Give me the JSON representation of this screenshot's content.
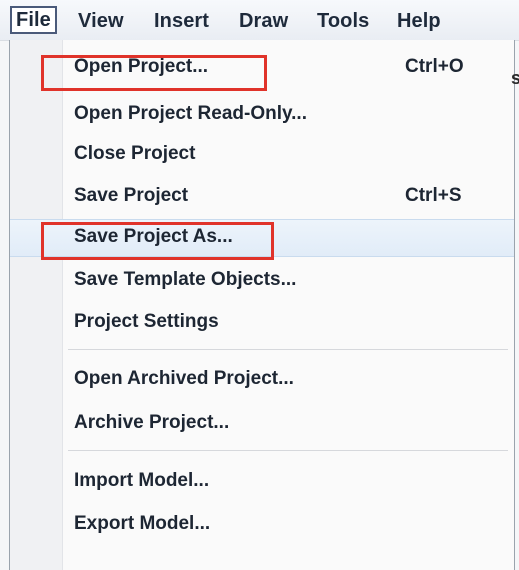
{
  "menubar": {
    "items": [
      {
        "label": "File"
      },
      {
        "label": "View"
      },
      {
        "label": "Insert"
      },
      {
        "label": "Draw"
      },
      {
        "label": "Tools"
      },
      {
        "label": "Help"
      }
    ]
  },
  "file_menu": {
    "items": [
      {
        "label": "Open Project...",
        "shortcut": "Ctrl+O"
      },
      {
        "label": "Open Project Read-Only..."
      },
      {
        "label": "Close Project"
      },
      {
        "label": "Save Project",
        "shortcut": "Ctrl+S"
      },
      {
        "label": "Save Project As..."
      },
      {
        "label": "Save Template Objects..."
      },
      {
        "label": "Project Settings"
      },
      {
        "label": "Open Archived Project..."
      },
      {
        "label": "Archive Project..."
      },
      {
        "label": "Import Model..."
      },
      {
        "label": "Export Model..."
      }
    ]
  },
  "edge_glyph": "s",
  "colors": {
    "highlight_border": "#e0332a",
    "hover_background": "#e5eef9"
  }
}
